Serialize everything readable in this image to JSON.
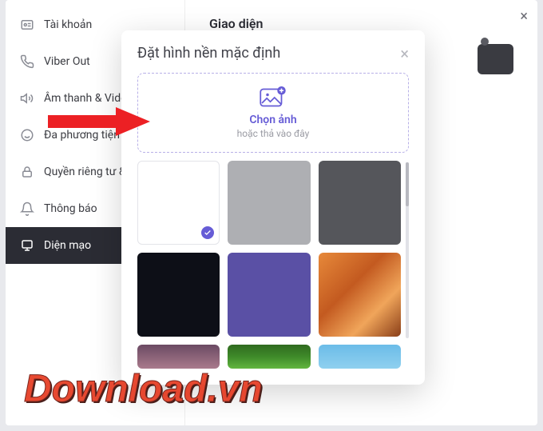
{
  "sidebar": {
    "items": [
      {
        "label": "Tài khoản",
        "icon": "account-icon"
      },
      {
        "label": "Viber Out",
        "icon": "phone-icon"
      },
      {
        "label": "Âm thanh & Video",
        "icon": "speaker-icon"
      },
      {
        "label": "Đa phương tiện",
        "icon": "smile-icon"
      },
      {
        "label": "Quyền riêng tư & Bảo mật",
        "icon": "lock-icon"
      },
      {
        "label": "Thông báo",
        "icon": "bell-icon"
      },
      {
        "label": "Diện mạo",
        "icon": "palette-icon"
      }
    ]
  },
  "main": {
    "page_title": "Giao diện"
  },
  "modal": {
    "title": "Đặt hình nền mặc định",
    "dropzone_label": "Chọn ảnh",
    "dropzone_sub": "hoặc thả vào đây",
    "thumbs": [
      {
        "bg": "#ffffff",
        "selected": true,
        "border": true
      },
      {
        "bg": "#aeafb3"
      },
      {
        "bg": "#55565b"
      },
      {
        "bg": "#0d0f17"
      },
      {
        "bg": "#5a50a5"
      },
      {
        "bg": "linear-gradient(135deg,#e7893a 0%,#c35a20 40%,#f0a55a 70%,#8a3e18 100%)"
      },
      {
        "bg": "linear-gradient(180deg,#6b4a63 0%,#a97a8c 100%)"
      },
      {
        "bg": "linear-gradient(180deg,#2f6a1f 0%,#3e8a29 50%,#63b640 100%)"
      },
      {
        "bg": "linear-gradient(180deg,#6bbce8 0%,#8fd0ef 100%)"
      }
    ]
  },
  "watermark": "Download.vn"
}
